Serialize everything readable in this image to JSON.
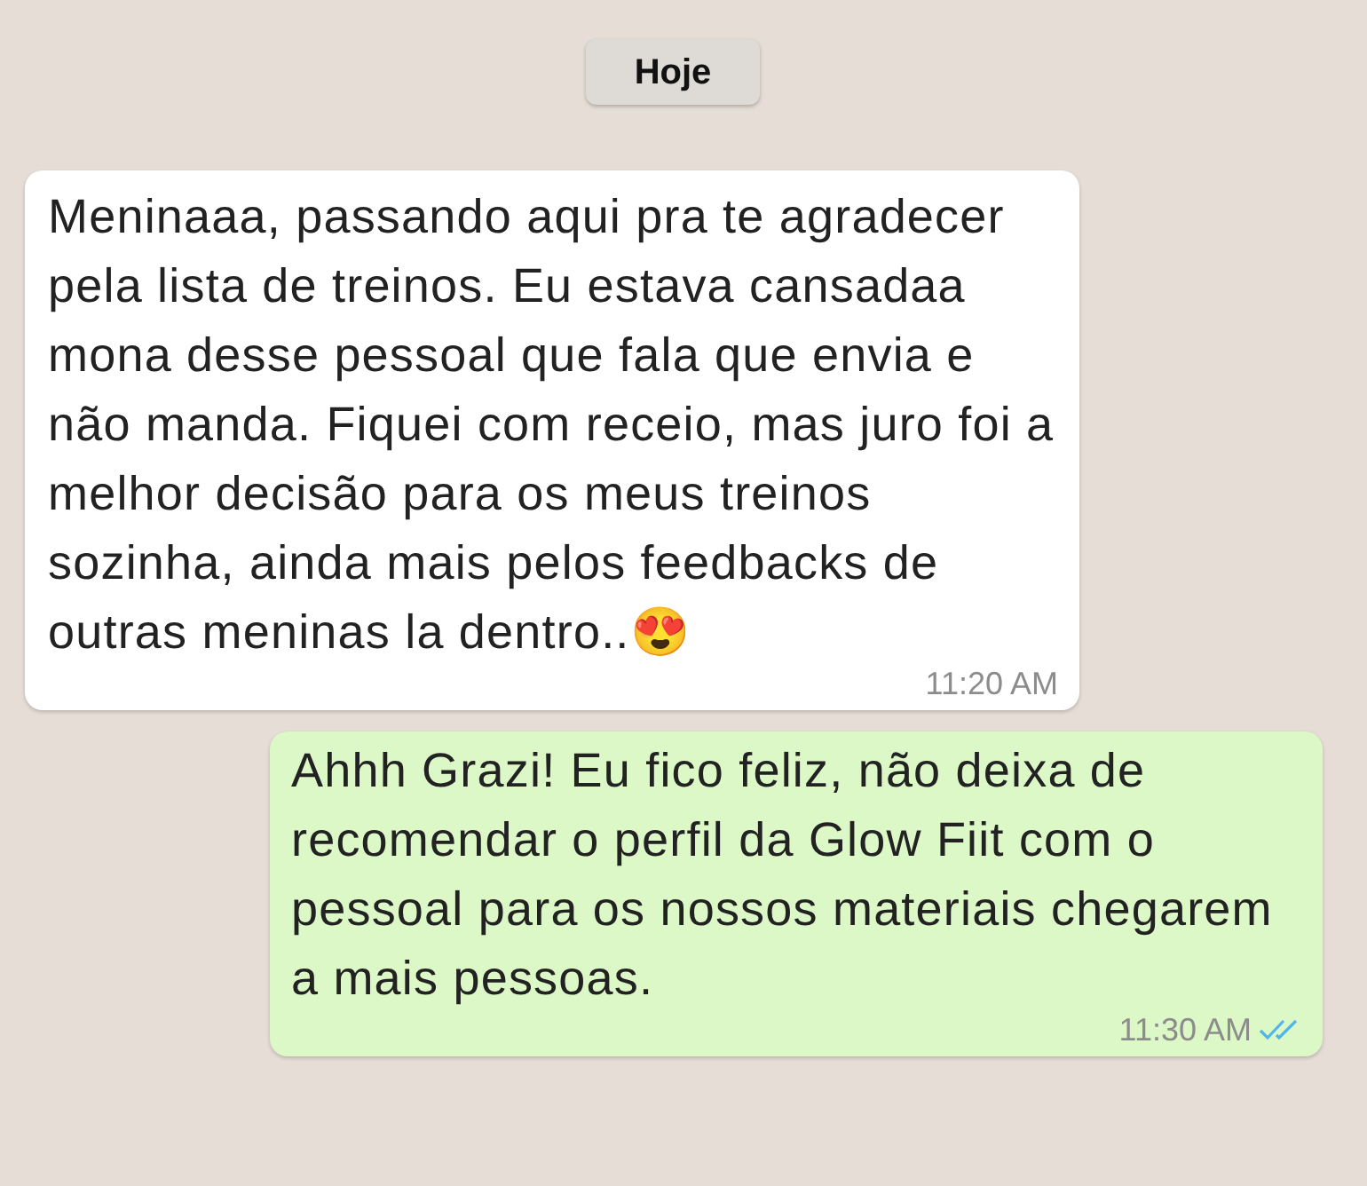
{
  "date_chip": "Hoje",
  "messages": [
    {
      "kind": "incoming",
      "text": "Meninaaa, passando aqui pra te agradecer pela lista de treinos. Eu estava cansadaa mona desse pessoal que fala que envia e não manda. Fiquei com receio, mas juro foi a melhor decisão para os meus treinos sozinha, ainda mais pelos feedbacks de outras meninas la dentro..😍",
      "time": "11:20 AM"
    },
    {
      "kind": "outgoing",
      "text": "Ahhh Grazi! Eu fico feliz, não deixa de recomendar o perfil da Glow Fiit com o pessoal para os nossos materiais chegarem a mais pessoas.",
      "time": "11:30 AM",
      "read": true
    }
  ]
}
